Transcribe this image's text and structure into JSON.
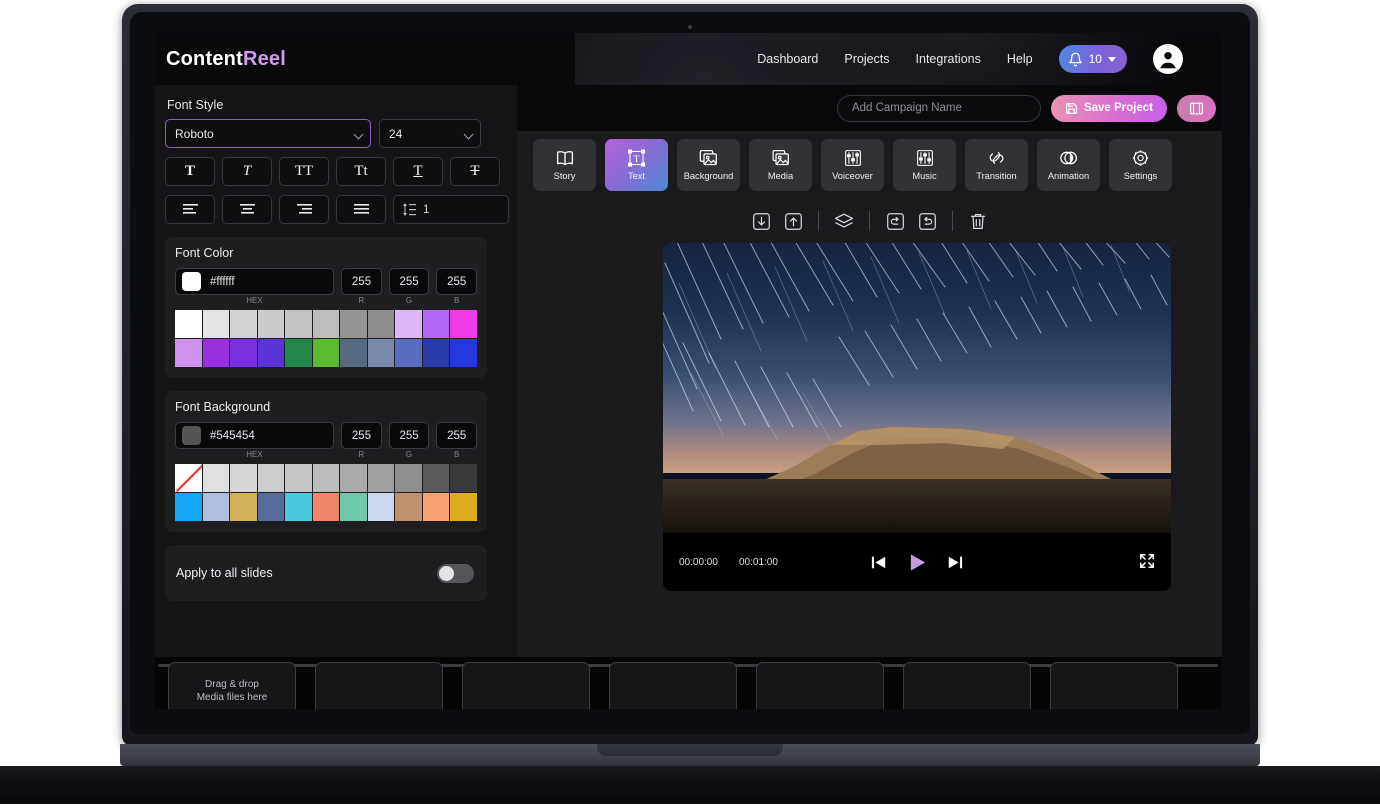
{
  "app": {
    "logo_primary": "Content",
    "logo_accent": "Reel"
  },
  "topnav": {
    "items": [
      {
        "label": "Dashboard"
      },
      {
        "label": "Projects"
      },
      {
        "label": "Integrations"
      },
      {
        "label": "Help"
      }
    ],
    "notification_count": "10",
    "notification_icon": "bell-icon",
    "avatar_icon": "user-avatar-icon"
  },
  "left_panel": {
    "font_style": {
      "label": "Font Style",
      "font_family_value": "Roboto",
      "font_size_value": "24",
      "style_buttons": [
        {
          "name": "bold",
          "glyph": "T"
        },
        {
          "name": "italic",
          "glyph": "T"
        },
        {
          "name": "uppercase",
          "glyph": "TT"
        },
        {
          "name": "capitalize",
          "glyph": "Tt"
        },
        {
          "name": "underline",
          "glyph": "T"
        },
        {
          "name": "strikethrough",
          "glyph": "T"
        }
      ],
      "align_buttons": [
        {
          "name": "align-left"
        },
        {
          "name": "align-center"
        },
        {
          "name": "align-right"
        },
        {
          "name": "align-justify"
        }
      ],
      "line_spacing_value": "1"
    },
    "font_color": {
      "title": "Font Color",
      "hex_value": "#ffffff",
      "hex_label": "HEX",
      "r_value": "255",
      "g_value": "255",
      "b_value": "255",
      "r_label": "R",
      "g_label": "G",
      "b_label": "B",
      "swatch_preview": "#ffffff",
      "palette_row1": [
        "#ffffff",
        "#e4e4e4",
        "#d3d3d3",
        "#cbcbcb",
        "#c4c4c4",
        "#bdbdbd",
        "#959595",
        "#8c8c8c",
        "#ddb6f7",
        "#b266f5",
        "#ef3ae8"
      ],
      "palette_row2": [
        "#cd93ee",
        "#9a2fdd",
        "#7a2fdc",
        "#5a33da",
        "#23874a",
        "#5abb31",
        "#556a80",
        "#7a89ab",
        "#5a6cc0",
        "#2a3aa8",
        "#2338dc"
      ]
    },
    "font_background": {
      "title": "Font Background",
      "hex_value": "#545454",
      "hex_label": "HEX",
      "r_value": "255",
      "g_value": "255",
      "b_value": "255",
      "r_label": "R",
      "g_label": "G",
      "b_label": "B",
      "swatch_preview": "#545454",
      "palette_row1": [
        "none",
        "#e0e0e0",
        "#d5d5d5",
        "#cccccc",
        "#c6c6c6",
        "#bcbcbc",
        "#aaaaaa",
        "#a0a0a0",
        "#8e8e8e",
        "#5a5a5a",
        "#3a3a3a"
      ],
      "palette_row2": [
        "#15a7f5",
        "#b0bde0",
        "#d3b057",
        "#566b9b",
        "#4dc6e0",
        "#f0866a",
        "#6ec9ac",
        "#ccd7f0",
        "#c08f6e",
        "#f8a070",
        "#ddab1c"
      ]
    },
    "apply_all": {
      "label": "Apply to all slides",
      "enabled": false
    }
  },
  "editor": {
    "campaign": {
      "placeholder": "Add Campaign Name",
      "value": "",
      "save_label": "Save Project",
      "save_icon": "save-disk-icon",
      "preview_icon": "film-strip-icon"
    },
    "tabs": [
      {
        "label": "Story",
        "icon": "book-icon",
        "active": false
      },
      {
        "label": "Text",
        "icon": "text-box-icon",
        "active": true
      },
      {
        "label": "Background",
        "icon": "image-stack-icon",
        "active": false
      },
      {
        "label": "Media",
        "icon": "image-icon",
        "active": false
      },
      {
        "label": "Voiceover",
        "icon": "sliders-icon",
        "active": false
      },
      {
        "label": "Music",
        "icon": "sliders-icon",
        "active": false
      },
      {
        "label": "Transition",
        "icon": "link-icon",
        "active": false
      },
      {
        "label": "Animation",
        "icon": "overlapping-circles-icon",
        "active": false
      },
      {
        "label": "Settings",
        "icon": "gear-icon",
        "active": false
      }
    ],
    "stage_tools": [
      {
        "name": "move-down-icon"
      },
      {
        "name": "move-up-icon"
      },
      {
        "name": "layers-icon"
      },
      {
        "name": "undo-icon"
      },
      {
        "name": "redo-icon"
      },
      {
        "name": "delete-icon"
      }
    ],
    "player": {
      "current_time": "00:00:00",
      "total_time": "00:01:00",
      "prev_icon": "skip-previous-icon",
      "play_icon": "play-icon",
      "next_icon": "skip-next-icon",
      "fullscreen_icon": "fullscreen-icon",
      "play_color": "#c39be0"
    }
  },
  "filmstrip": {
    "slots": [
      {
        "label": "Drag & drop\nMedia files here"
      },
      {
        "label": ""
      },
      {
        "label": ""
      },
      {
        "label": ""
      },
      {
        "label": ""
      },
      {
        "label": ""
      },
      {
        "label": ""
      }
    ]
  }
}
